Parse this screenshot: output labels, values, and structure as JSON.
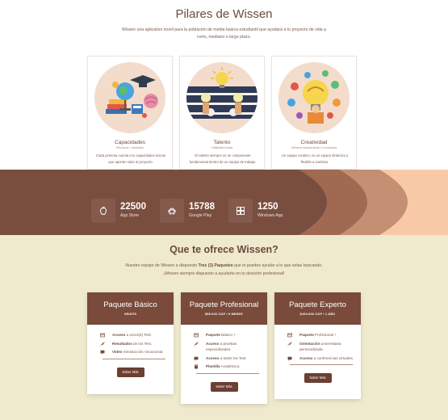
{
  "pilares": {
    "title": "Pilares de Wissen",
    "intro": "Wissen una aplicativo movil para la población de media básica estudiantil que ayudará a tu proyecto de vida a corto, mediano o largo plazo.",
    "cards": [
      {
        "title": "Capacidades",
        "subtitle": "Recursos + Actitudes",
        "desc": "Cada persona cuenta con capacidades únicas que aportan valor al proyecto."
      },
      {
        "title": "Talento",
        "subtitle": "Habilidad Innata",
        "desc": "El talento siempre es un componente fundamental dentro de un equipo de trabajo."
      },
      {
        "title": "Creatividad",
        "subtitle": "Generar nuevas ideas o Conceptos",
        "desc": "Un equipo creativo, es un equipo dinámico y flexible a cambios."
      }
    ]
  },
  "stats": [
    {
      "number": "22500",
      "label": "App Store",
      "icon": "apple-icon"
    },
    {
      "number": "15788",
      "label": "Google Play",
      "icon": "android-icon"
    },
    {
      "number": "1250",
      "label": "Windows App",
      "icon": "windows-icon"
    }
  ],
  "ofrece": {
    "title": "Que te ofrece Wissen?",
    "line1_a": "Nuestro equipo de Wissen a dispuesto ",
    "line1_b": "Tres (3) Paquetes",
    "line1_c": " que te pueden ayudar a lo que estas buscando.",
    "line2": "¡Wissen siempre dispuesto a ayudarte en tu desición profesional!",
    "packages": [
      {
        "name": "Paquete Básico",
        "price": "GRATIS",
        "button": "Saber Más",
        "features": [
          {
            "icon": "mail-icon",
            "bold": "Acceso",
            "text": " a unico(5) Test."
          },
          {
            "icon": "rocket-icon",
            "bold": "Resultados",
            "text": " de los Test."
          },
          {
            "icon": "chat-icon",
            "bold": "Video",
            "text": " Introducción Vocacional."
          }
        ]
      },
      {
        "name": "Paquete Profesional",
        "price": "$55.000 COP / 6 MESES",
        "button": "Saber Más",
        "features": [
          {
            "icon": "mail-icon",
            "bold": "Paquete",
            "text": " Básico +"
          },
          {
            "icon": "rocket-icon",
            "bold": "Acceso",
            "text": " a pruebas especializadas."
          },
          {
            "icon": "chat-icon",
            "bold": "Acceso",
            "text": " a todos los Test."
          },
          {
            "icon": "book-icon",
            "bold": "Plantilla",
            "text": " Académica."
          }
        ]
      },
      {
        "name": "Paquete Experto",
        "price": "$100.000 COP / 1 AÑO",
        "button": "Saber Más",
        "features": [
          {
            "icon": "mail-icon",
            "bold": "Paquete",
            "text": " Profesional +"
          },
          {
            "icon": "rocket-icon",
            "bold": "Orientación",
            "text": " universitaria personalizada."
          },
          {
            "icon": "chat-icon",
            "bold": "Acceso",
            "text": " a conferencias virtuales."
          }
        ]
      }
    ]
  },
  "colors": {
    "brown": "#6b4a3f",
    "dark_brown": "#7a4a3a",
    "peach": "#f8c9a6",
    "cream": "#efe9cd",
    "circle": "#f3dccb"
  }
}
